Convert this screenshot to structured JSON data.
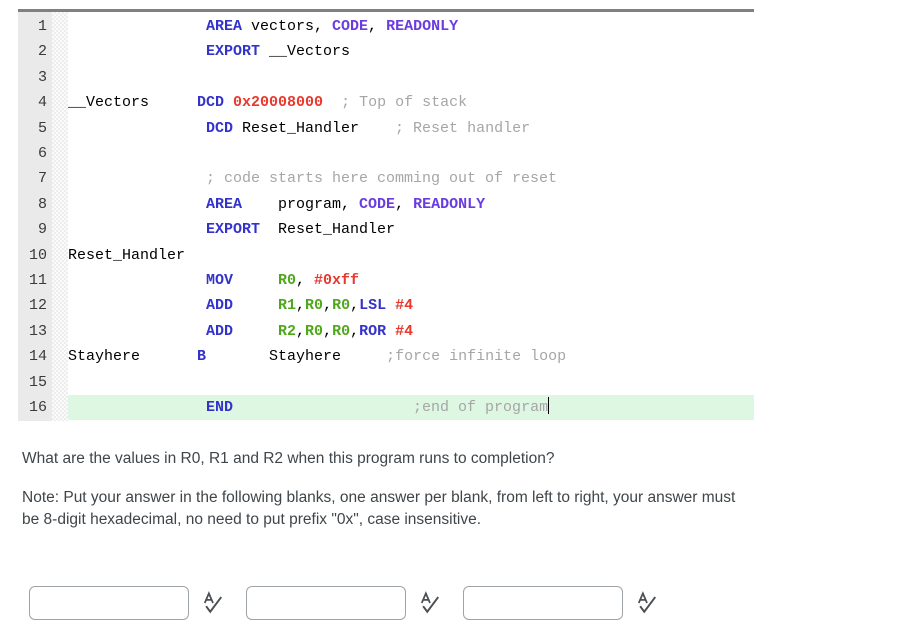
{
  "editor": {
    "top_border_color": "#808080",
    "highlight_color": "#ddf7e3",
    "gutter_color": "#eaeaea",
    "line_numbers": [
      "1",
      "2",
      "3",
      "4",
      "5",
      "6",
      "7",
      "8",
      "9",
      "10",
      "11",
      "12",
      "13",
      "14",
      "15",
      "16"
    ],
    "lines": [
      {
        "n": "1",
        "label": "",
        "text": "AREA vectors, CODE, READONLY",
        "highlighted": false
      },
      {
        "n": "2",
        "label": "",
        "text": "EXPORT __Vectors",
        "highlighted": false
      },
      {
        "n": "3",
        "label": "",
        "text": "",
        "highlighted": false
      },
      {
        "n": "4",
        "label": "__Vectors",
        "text": "DCD 0x20008000  ; Top of stack",
        "highlighted": false
      },
      {
        "n": "5",
        "label": "",
        "text": "DCD Reset_Handler   ; Reset handler",
        "highlighted": false
      },
      {
        "n": "6",
        "label": "",
        "text": "",
        "highlighted": false
      },
      {
        "n": "7",
        "label": "",
        "text": "; code starts here comming out of reset",
        "highlighted": false
      },
      {
        "n": "8",
        "label": "",
        "text": "AREA    program, CODE, READONLY",
        "highlighted": false
      },
      {
        "n": "9",
        "label": "",
        "text": "EXPORT  Reset_Handler",
        "highlighted": false
      },
      {
        "n": "10",
        "label": "Reset_Handler",
        "text": "",
        "highlighted": false
      },
      {
        "n": "11",
        "label": "",
        "text": "MOV     R0, #0xff",
        "highlighted": false
      },
      {
        "n": "12",
        "label": "",
        "text": "ADD     R1,R0,R0,LSL #4",
        "highlighted": false
      },
      {
        "n": "13",
        "label": "",
        "text": "ADD     R2,R0,R0,ROR #4",
        "highlighted": false
      },
      {
        "n": "14",
        "label": "Stayhere",
        "text": "B       Stayhere    ;force infinite loop",
        "highlighted": false
      },
      {
        "n": "15",
        "label": "",
        "text": "",
        "highlighted": false
      },
      {
        "n": "16",
        "label": "",
        "text": "END                     ;end of program",
        "highlighted": true
      }
    ],
    "code_text": {
      "l1_area": "AREA",
      "l1_vectors": " vectors, ",
      "l1_code": "CODE",
      "l1_comma": ", ",
      "l1_readonly": "READONLY",
      "l2_export": "EXPORT",
      "l2_vectors": " __Vectors",
      "l4_label": "__Vectors",
      "l4_dcd": "DCD",
      "l4_val": " 0x20008000",
      "l4_cmt": "  ; Top of stack",
      "l5_dcd": "DCD",
      "l5_sym": " Reset_Handler",
      "l5_cmt": "    ; Reset handler",
      "l7_cmt": "; code starts here comming out of reset",
      "l8_area": "AREA",
      "l8_program": "    program, ",
      "l8_code": "CODE",
      "l8_comma": ", ",
      "l8_readonly": "READONLY",
      "l9_export": "EXPORT",
      "l9_sym": "  Reset_Handler",
      "l10_label": "Reset_Handler",
      "l11_mn": "MOV",
      "l11_reg": "     R0",
      "l11_sep": ", ",
      "l11_imm": "#0xff",
      "l12_mn": "ADD",
      "l12_r1": "     R1",
      "l12_c1": ",",
      "l12_r2": "R0",
      "l12_c2": ",",
      "l12_r3": "R0",
      "l12_c3": ",",
      "l12_shift": "LSL ",
      "l12_imm": "#4",
      "l13_mn": "ADD",
      "l13_r1": "     R2",
      "l13_c1": ",",
      "l13_r2": "R0",
      "l13_c2": ",",
      "l13_r3": "R0",
      "l13_c3": ",",
      "l13_shift": "ROR ",
      "l13_imm": "#4",
      "l14_label": "Stayhere",
      "l14_mn": "B",
      "l14_target": "       Stayhere",
      "l14_cmt": "     ;force infinite loop",
      "l16_end": "END",
      "l16_cmt": "                    ;end of program"
    }
  },
  "question": {
    "prompt": "What are the values in R0, R1 and R2 when this program runs to completion?",
    "note": "Note: Put your answer in the following blanks, one answer per blank, from left to right, your answer must be 8-digit hexadecimal, no need to put prefix \"0x\", case insensitive."
  },
  "answers": {
    "blanks": [
      {
        "value": "",
        "placeholder": "",
        "icon": "spellcheck-icon"
      },
      {
        "value": "",
        "placeholder": "",
        "icon": "spellcheck-icon"
      },
      {
        "value": "",
        "placeholder": "",
        "icon": "spellcheck-icon"
      }
    ]
  }
}
